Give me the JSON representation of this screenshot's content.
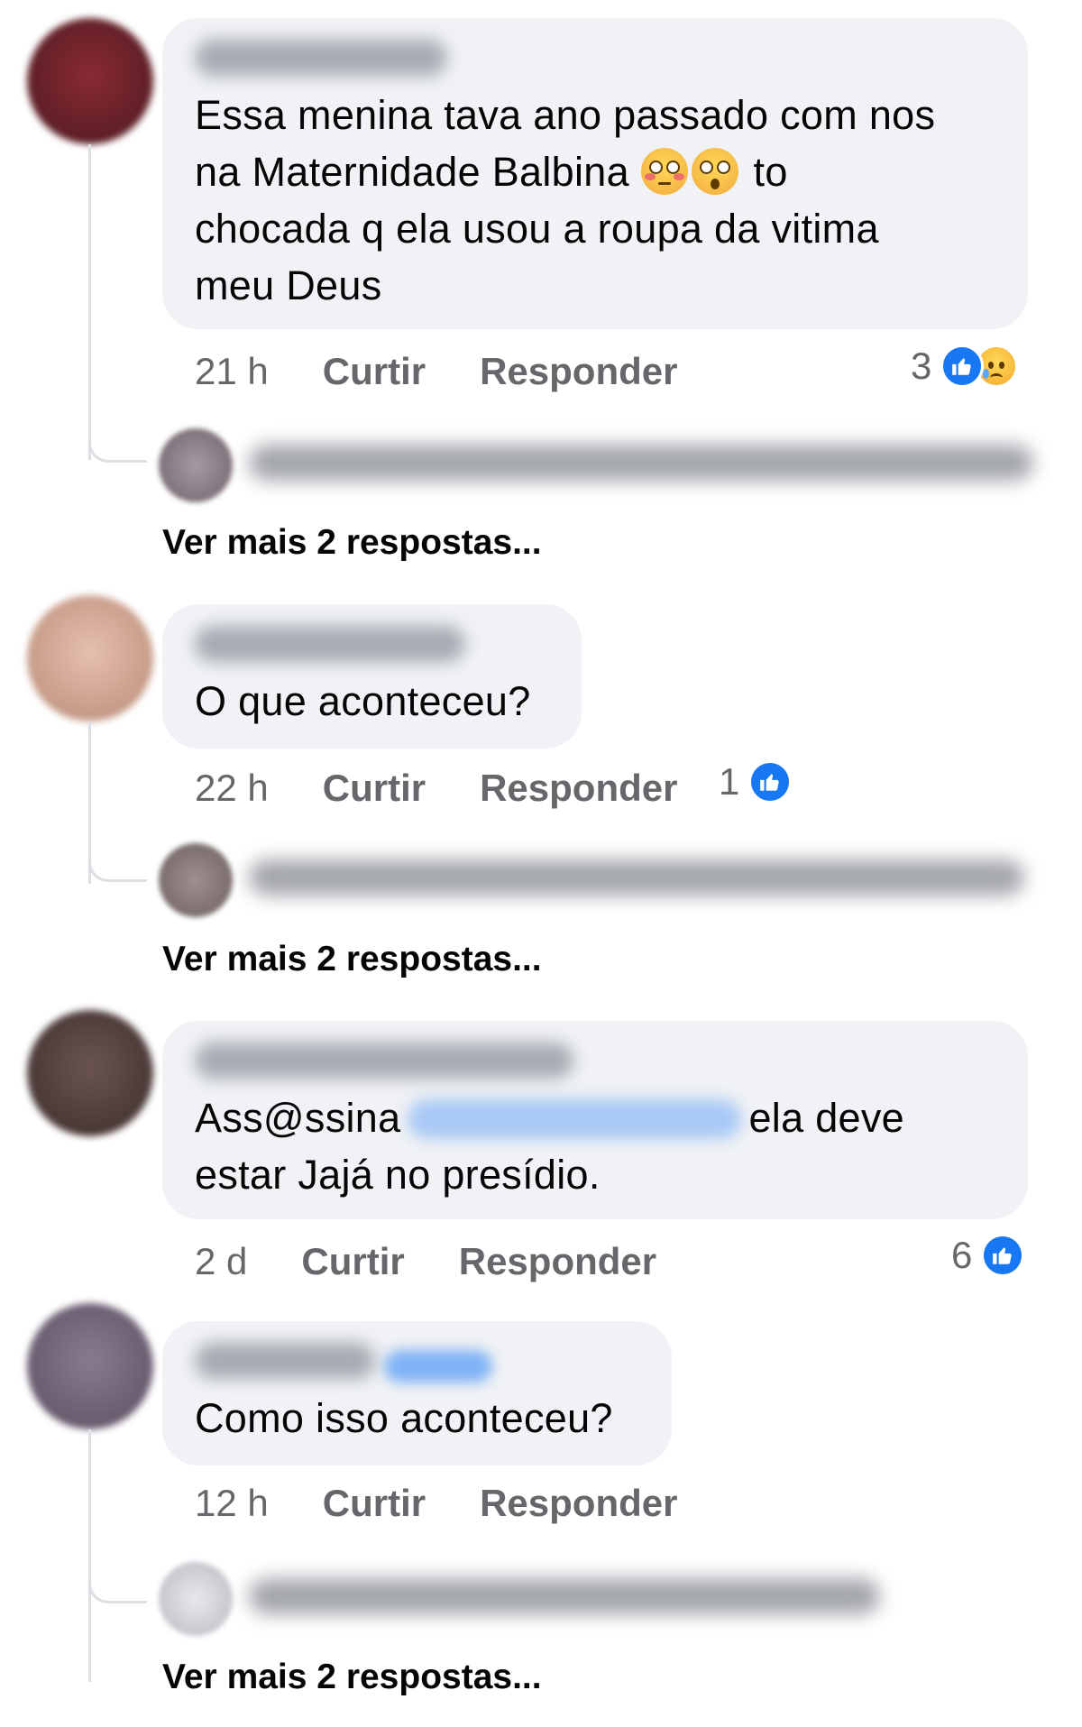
{
  "comments": [
    {
      "text_line1": "Essa menina tava ano passado com nos",
      "text_line2a": "na Maternidade Balbina ",
      "text_line2b": " to",
      "text_line3": "chocada q ela usou a roupa da vitima",
      "text_line4": "meu Deus",
      "time": "21 h",
      "like_label": "Curtir",
      "reply_label": "Responder",
      "reaction_count": "3",
      "more_replies": "Ver mais 2 respostas..."
    },
    {
      "text": "O que aconteceu?",
      "time": "22 h",
      "like_label": "Curtir",
      "reply_label": "Responder",
      "reaction_count": "1",
      "more_replies": "Ver mais 2 respostas..."
    },
    {
      "text_a": "Ass@ssina",
      "text_b": "ela deve",
      "text_line2": "estar Jajá no presídio.",
      "time": "2 d",
      "like_label": "Curtir",
      "reply_label": "Responder",
      "reaction_count": "6"
    },
    {
      "text": "Como isso aconteceu?",
      "time": "12 h",
      "like_label": "Curtir",
      "reply_label": "Responder",
      "more_replies": "Ver mais 2 respostas..."
    }
  ],
  "colors": {
    "bubble": "#f0f2f5",
    "meta_text": "#65676b",
    "like_blue": "#1877f2",
    "thread_line": "#dddfe3"
  },
  "icons": [
    "like-reaction-icon",
    "sad-reaction-icon",
    "flushed-face-emoji",
    "astonished-face-emoji"
  ]
}
